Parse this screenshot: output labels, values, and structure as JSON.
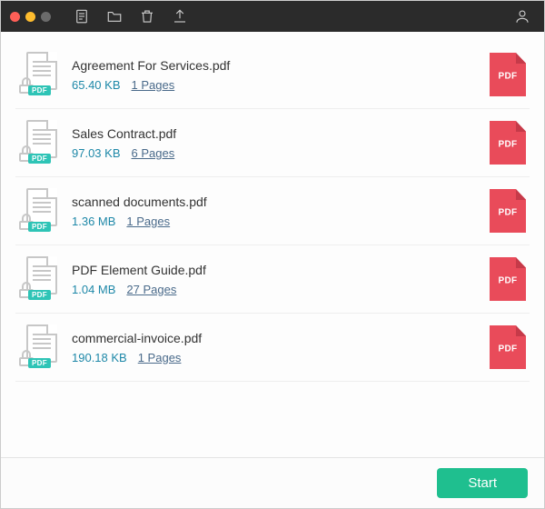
{
  "toolbar": {
    "pdf_tag": "PDF",
    "badge_label": "PDF"
  },
  "files": [
    {
      "name": "Agreement For Services.pdf",
      "size": "65.40 KB",
      "pages": "1 Pages"
    },
    {
      "name": "Sales Contract.pdf",
      "size": "97.03 KB",
      "pages": "6 Pages"
    },
    {
      "name": "scanned documents.pdf",
      "size": "1.36 MB",
      "pages": "1 Pages"
    },
    {
      "name": "PDF Element Guide.pdf",
      "size": "1.04 MB",
      "pages": "27 Pages"
    },
    {
      "name": "commercial-invoice.pdf",
      "size": "190.18 KB",
      "pages": "1 Pages"
    }
  ],
  "footer": {
    "start_label": "Start"
  }
}
